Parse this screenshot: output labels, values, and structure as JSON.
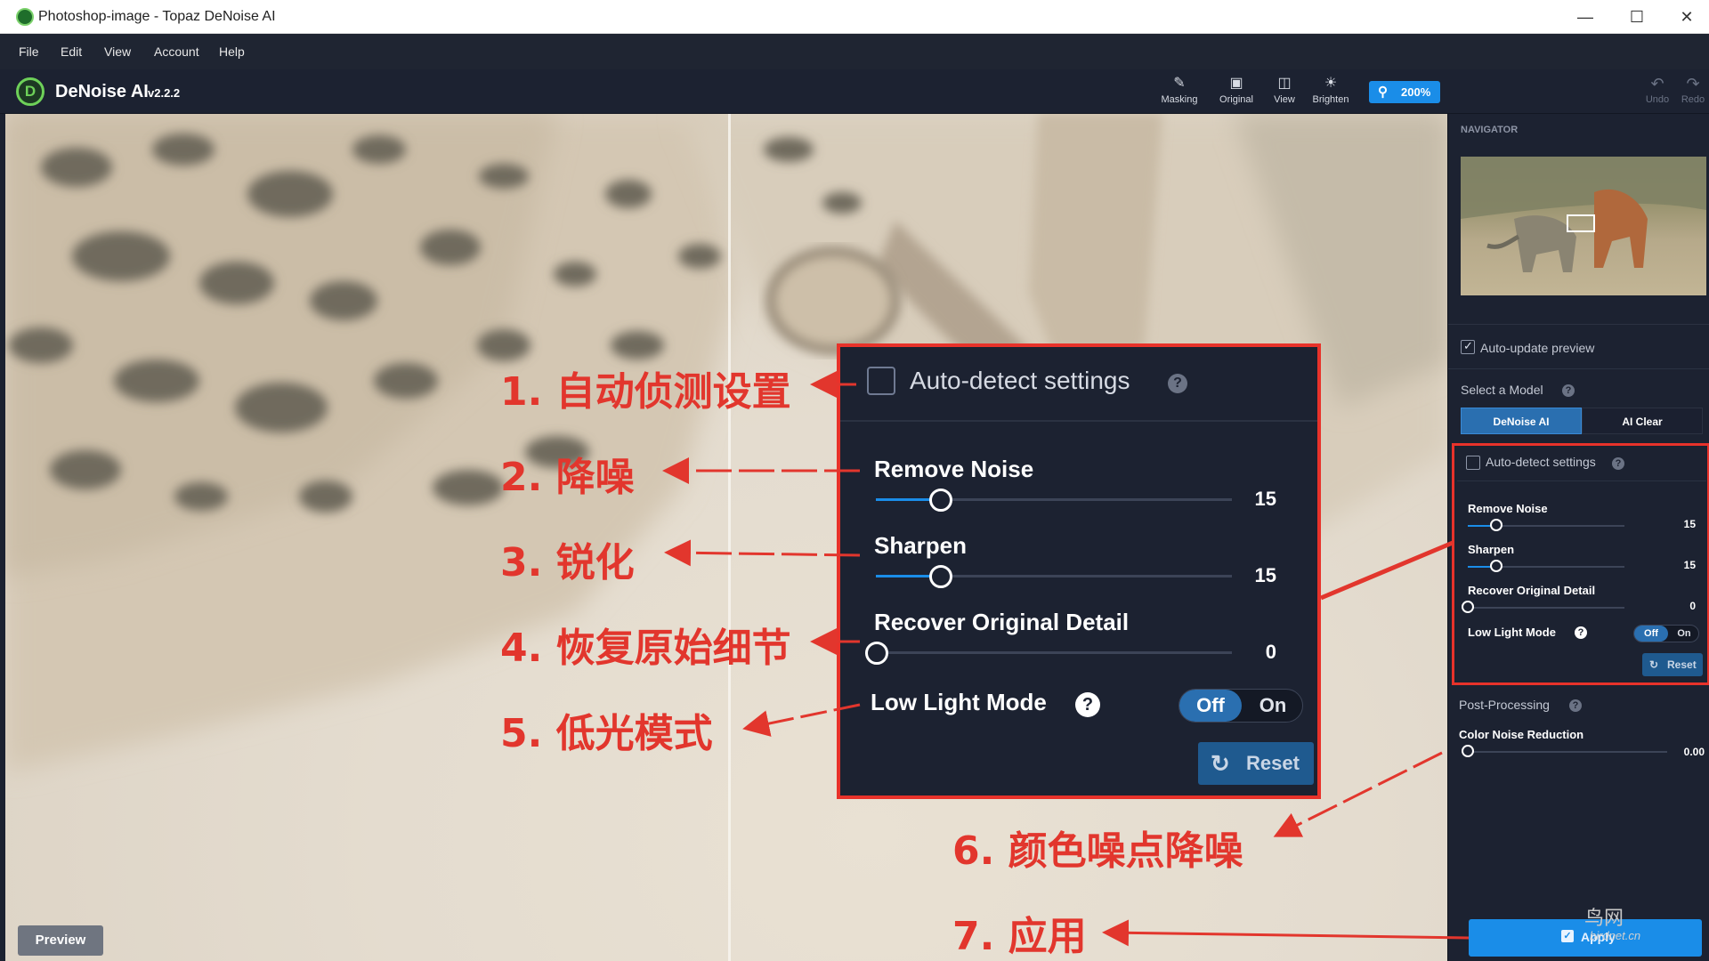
{
  "window": {
    "title": "Photoshop-image - Topaz DeNoise AI",
    "minimize": "—",
    "maximize": "☐",
    "close": "✕"
  },
  "menu": [
    "File",
    "Edit",
    "View",
    "Account",
    "Help"
  ],
  "app": {
    "name": "DeNoise AI",
    "version": "v2.2.2",
    "logo_letter": "D"
  },
  "toolbar": {
    "masking": "Masking",
    "original": "Original",
    "view": "View",
    "brighten": "Brighten",
    "zoom": "200%",
    "undo": "Undo",
    "redo": "Redo"
  },
  "canvas": {
    "preview_label": "Preview"
  },
  "panel": {
    "navigator_title": "NAVIGATOR",
    "auto_update": "Auto-update preview",
    "auto_update_checked": true,
    "select_model": "Select a Model",
    "models": [
      "DeNoise AI",
      "AI Clear"
    ],
    "selected_model": "DeNoise AI",
    "auto_detect": "Auto-detect settings",
    "auto_detect_checked": false,
    "sliders": [
      {
        "label": "Remove Noise",
        "value": "15",
        "fraction": 0.18
      },
      {
        "label": "Sharpen",
        "value": "15",
        "fraction": 0.18
      },
      {
        "label": "Recover Original Detail",
        "value": "0",
        "fraction": 0.0
      }
    ],
    "low_light": "Low Light Mode",
    "low_light_off": "Off",
    "low_light_on": "On",
    "reset": "Reset",
    "post_processing": "Post-Processing",
    "color_noise": "Color Noise Reduction",
    "color_noise_value": "0.00",
    "color_noise_fraction": 0.0,
    "apply": "Apply"
  },
  "callout": {
    "auto_detect": "Auto-detect settings",
    "remove_noise": "Remove Noise",
    "remove_noise_value": "15",
    "sharpen": "Sharpen",
    "sharpen_value": "15",
    "recover": "Recover Original Detail",
    "recover_value": "0",
    "low_light": "Low Light Mode",
    "off": "Off",
    "on": "On",
    "reset": "Reset"
  },
  "annotations": {
    "a1_num": "1.",
    "a1_text": "自动侦测设置",
    "a2_num": "2.",
    "a2_text": "降噪",
    "a3_num": "3.",
    "a3_text": "锐化",
    "a4_num": "4.",
    "a4_text": "恢复原始细节",
    "a5_num": "5.",
    "a5_text": "低光模式",
    "a6_num": "6.",
    "a6_text": "颜色噪点降噪",
    "a7_num": "7.",
    "a7_text": "应用"
  },
  "watermark": {
    "line1": "鸟网",
    "line2": "birdnet.cn"
  },
  "colors": {
    "accent_blue": "#1a8de8",
    "annotation_red": "#e2362d",
    "panel_bg": "#1c2231",
    "logo_green": "#6ed159"
  }
}
